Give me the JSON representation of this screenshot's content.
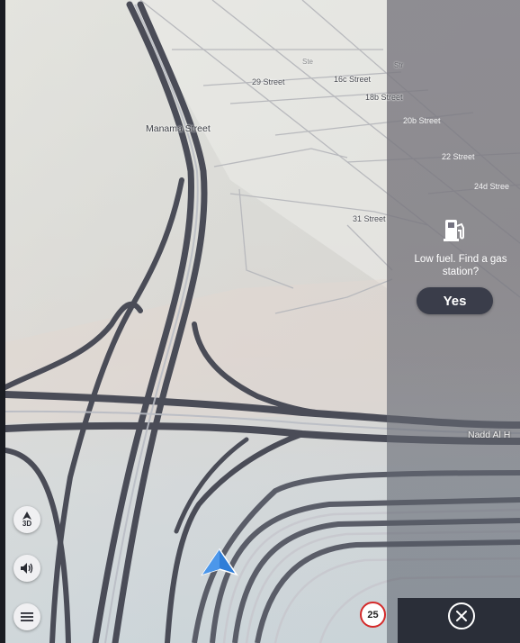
{
  "map": {
    "streets": {
      "manama": "Manama Street",
      "s29": "29 Street",
      "s16c": "16c Street",
      "s18b": "18b Street",
      "s20b": "20b Street",
      "s22": "22 Street",
      "s24d": "24d Stree",
      "s31": "31 Street",
      "nadd": "Nadd Al H"
    }
  },
  "fuel_prompt": {
    "text": "Low fuel. Find a gas station?",
    "yes_label": "Yes",
    "icon": "gas-pump-icon"
  },
  "controls": {
    "view_mode_label": "3D",
    "view_mode_icon": "compass-arrow-icon",
    "sound_icon": "speaker-icon",
    "menu_icon": "menu-icon",
    "close_icon": "close-icon"
  },
  "speed_limit": "25",
  "colors": {
    "road": "#4a4c57",
    "speed_ring": "#d42a2a",
    "vehicle_arrow": "#2f7ed8",
    "button_dark": "#3a3d4a"
  }
}
